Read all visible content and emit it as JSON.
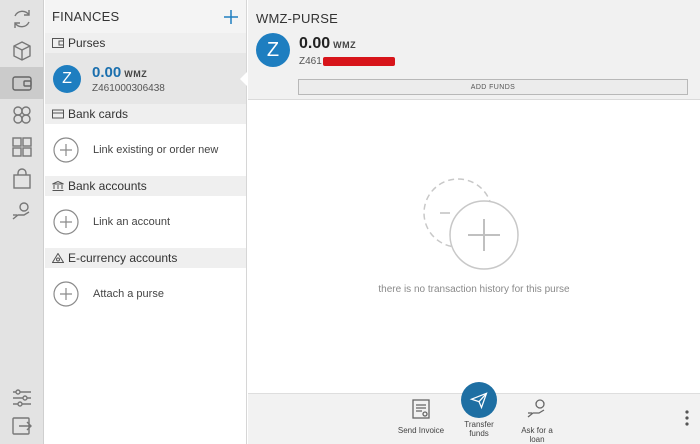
{
  "rail": {
    "items": [
      "sync-icon",
      "cube-icon",
      "wallet-icon",
      "coins-icon",
      "apps-icon",
      "shopping-bag-icon",
      "hand-coin-icon"
    ],
    "active": "wallet-icon",
    "bottom": [
      "settings-sliders-icon",
      "logout-icon"
    ]
  },
  "finances": {
    "title": "FINANCES",
    "sections": {
      "purses": "Purses",
      "bank_cards": "Bank cards",
      "bank_accounts": "Bank accounts",
      "ecurrency": "E-currency accounts"
    },
    "purse": {
      "initial": "Z",
      "amount": "0.00",
      "currency": "WMZ",
      "id": "Z461000306438"
    },
    "links": {
      "card": "Link existing or order new",
      "account": "Link an account",
      "purse": "Attach a purse"
    }
  },
  "main": {
    "title": "WMZ-PURSE",
    "initial": "Z",
    "amount": "0.00",
    "currency": "WMZ",
    "id_prefix": "Z461",
    "add_funds": "ADD FUNDS",
    "empty_text": "there is no transaction history for this purse"
  },
  "actions": {
    "send_invoice": "Send Invoice",
    "transfer_1": "Transfer",
    "transfer_2": "funds",
    "loan_1": "Ask for a",
    "loan_2": "loan"
  },
  "colors": {
    "accent": "#1e7ec0",
    "transfer": "#1e6fa3",
    "redaction": "#d7141a"
  }
}
